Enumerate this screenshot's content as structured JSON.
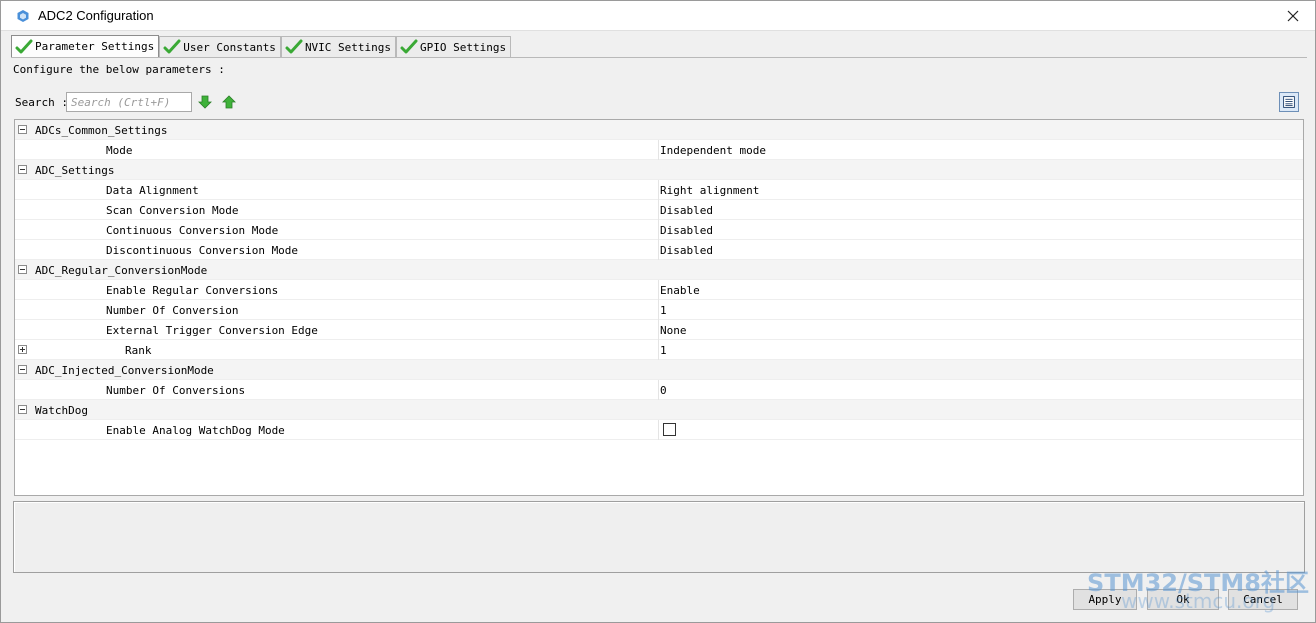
{
  "window": {
    "title": "ADC2 Configuration",
    "accent_color": "#2f7fd0"
  },
  "tabs": [
    {
      "label": "Parameter Settings",
      "active": true,
      "icon": "green-check-icon"
    },
    {
      "label": "User Constants",
      "active": false,
      "icon": "green-check-icon"
    },
    {
      "label": "NVIC Settings",
      "active": false,
      "icon": "green-check-icon"
    },
    {
      "label": "GPIO Settings",
      "active": false,
      "icon": "green-check-icon"
    }
  ],
  "configure_label": "Configure the below parameters :",
  "search": {
    "label": "Search :",
    "placeholder": "Search (Crtl+F)"
  },
  "parameters": {
    "groups": [
      {
        "name": "ADCs_Common_Settings",
        "items": [
          {
            "name": "Mode",
            "value": "Independent mode"
          }
        ]
      },
      {
        "name": "ADC_Settings",
        "items": [
          {
            "name": "Data Alignment",
            "value": "Right alignment"
          },
          {
            "name": "Scan Conversion Mode",
            "value": "Disabled"
          },
          {
            "name": "Continuous Conversion Mode",
            "value": "Disabled"
          },
          {
            "name": "Discontinuous Conversion Mode",
            "value": "Disabled"
          }
        ]
      },
      {
        "name": "ADC_Regular_ConversionMode",
        "items": [
          {
            "name": "Enable Regular Conversions",
            "value": "Enable"
          },
          {
            "name": "Number Of Conversion",
            "value": "1"
          },
          {
            "name": "External Trigger Conversion Edge",
            "value": "None"
          },
          {
            "name": "Rank",
            "value": "1"
          }
        ]
      },
      {
        "name": "ADC_Injected_ConversionMode",
        "items": [
          {
            "name": "Number Of Conversions",
            "value": "0"
          }
        ]
      },
      {
        "name": "WatchDog",
        "items": [
          {
            "name": "Enable Analog WatchDog Mode",
            "value": "",
            "checked": false
          }
        ]
      }
    ]
  },
  "buttons": {
    "apply": "Apply",
    "ok": "Ok",
    "cancel": "Cancel"
  },
  "watermark": {
    "brand": "STM32/STM8社区",
    "url": "www.stmcu.org"
  },
  "colors": {
    "check_green": "#3aa935",
    "arrow_green": "#3fb23a"
  }
}
